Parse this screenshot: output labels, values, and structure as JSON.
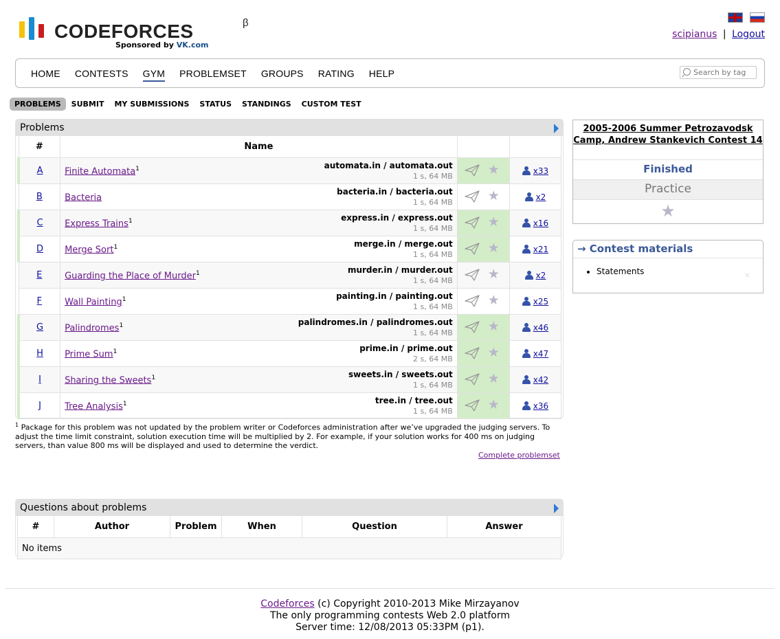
{
  "header": {
    "logo_text": "CODEFORCES",
    "logo_sup": "β",
    "sponsor_prefix": "Sponsored by ",
    "sponsor_name": "VK.com",
    "username": "scipianus",
    "separator": "|",
    "logout": "Logout",
    "flags": [
      "english-flag-icon",
      "russian-flag-icon"
    ]
  },
  "menu": {
    "items": [
      "HOME",
      "CONTESTS",
      "GYM",
      "PROBLEMSET",
      "GROUPS",
      "RATING",
      "HELP"
    ],
    "active": "GYM",
    "search_placeholder": "Search by tag"
  },
  "submenu": [
    "PROBLEMS",
    "SUBMIT",
    "MY SUBMISSIONS",
    "STATUS",
    "STANDINGS",
    "CUSTOM TEST"
  ],
  "problems": {
    "caption": "Problems",
    "headers": [
      "#",
      "Name",
      "",
      ""
    ],
    "rows": [
      {
        "id": "A",
        "name": "Finite Automata",
        "sup": "1",
        "io": "automata.in / automata.out",
        "limits": "1 s, 64 MB",
        "solved": "x33",
        "accepted": true
      },
      {
        "id": "B",
        "name": "Bacteria",
        "sup": "",
        "io": "bacteria.in / bacteria.out",
        "limits": "1 s, 64 MB",
        "solved": "x2",
        "accepted": false
      },
      {
        "id": "C",
        "name": "Express Trains",
        "sup": "1",
        "io": "express.in / express.out",
        "limits": "1 s, 64 MB",
        "solved": "x16",
        "accepted": true
      },
      {
        "id": "D",
        "name": "Merge Sort",
        "sup": "1",
        "io": "merge.in / merge.out",
        "limits": "1 s, 64 MB",
        "solved": "x21",
        "accepted": true
      },
      {
        "id": "E",
        "name": "Guarding the Place of Murder",
        "sup": "1",
        "io": "murder.in / murder.out",
        "limits": "1 s, 64 MB",
        "solved": "x2",
        "accepted": false
      },
      {
        "id": "F",
        "name": "Wall Painting",
        "sup": "1",
        "io": "painting.in / painting.out",
        "limits": "1 s, 64 MB",
        "solved": "x25",
        "accepted": false
      },
      {
        "id": "G",
        "name": "Palindromes",
        "sup": "1",
        "io": "palindromes.in / palindromes.out",
        "limits": "1 s, 64 MB",
        "solved": "x46",
        "accepted": true
      },
      {
        "id": "H",
        "name": "Prime Sum",
        "sup": "1",
        "io": "prime.in / prime.out",
        "limits": "2 s, 64 MB",
        "solved": "x47",
        "accepted": true
      },
      {
        "id": "I",
        "name": "Sharing the Sweets",
        "sup": "1",
        "io": "sweets.in / sweets.out",
        "limits": "1 s, 64 MB",
        "solved": "x42",
        "accepted": true
      },
      {
        "id": "J",
        "name": "Tree Analysis",
        "sup": "1",
        "io": "tree.in / tree.out",
        "limits": "1 s, 64 MB",
        "solved": "x36",
        "accepted": true
      }
    ]
  },
  "footnote": {
    "sup": "1",
    "text": " Package for this problem was not updated by the problem writer or Codeforces administration after we’ve upgraded the judging servers. To adjust the time limit constraint, solution execution time will be multiplied by 2. For example, if your solution works for 400 ms on judging servers, than value 800 ms will be displayed and used to determine the verdict.",
    "complete_link": "Complete problemset"
  },
  "questions": {
    "caption": "Questions about problems",
    "headers": [
      "#",
      "Author",
      "Problem",
      "When",
      "Question",
      "Answer"
    ],
    "empty": "No items"
  },
  "sidebar": {
    "contest_name": "2005-2006 Summer Petrozavodsk Camp, Andrew Stankevich Contest 14",
    "status": "Finished",
    "phase": "Practice",
    "materials_title": "→ Contest materials",
    "materials": [
      "Statements"
    ],
    "remove_glyph": "×"
  },
  "footer": {
    "link": "Codeforces",
    "copyright": " (c) Copyright 2010-2013 Mike Mirzayanov",
    "line2": "The only programming contests Web 2.0 platform",
    "line3": "Server time: 12/08/2013 05:33PM (p1)."
  }
}
